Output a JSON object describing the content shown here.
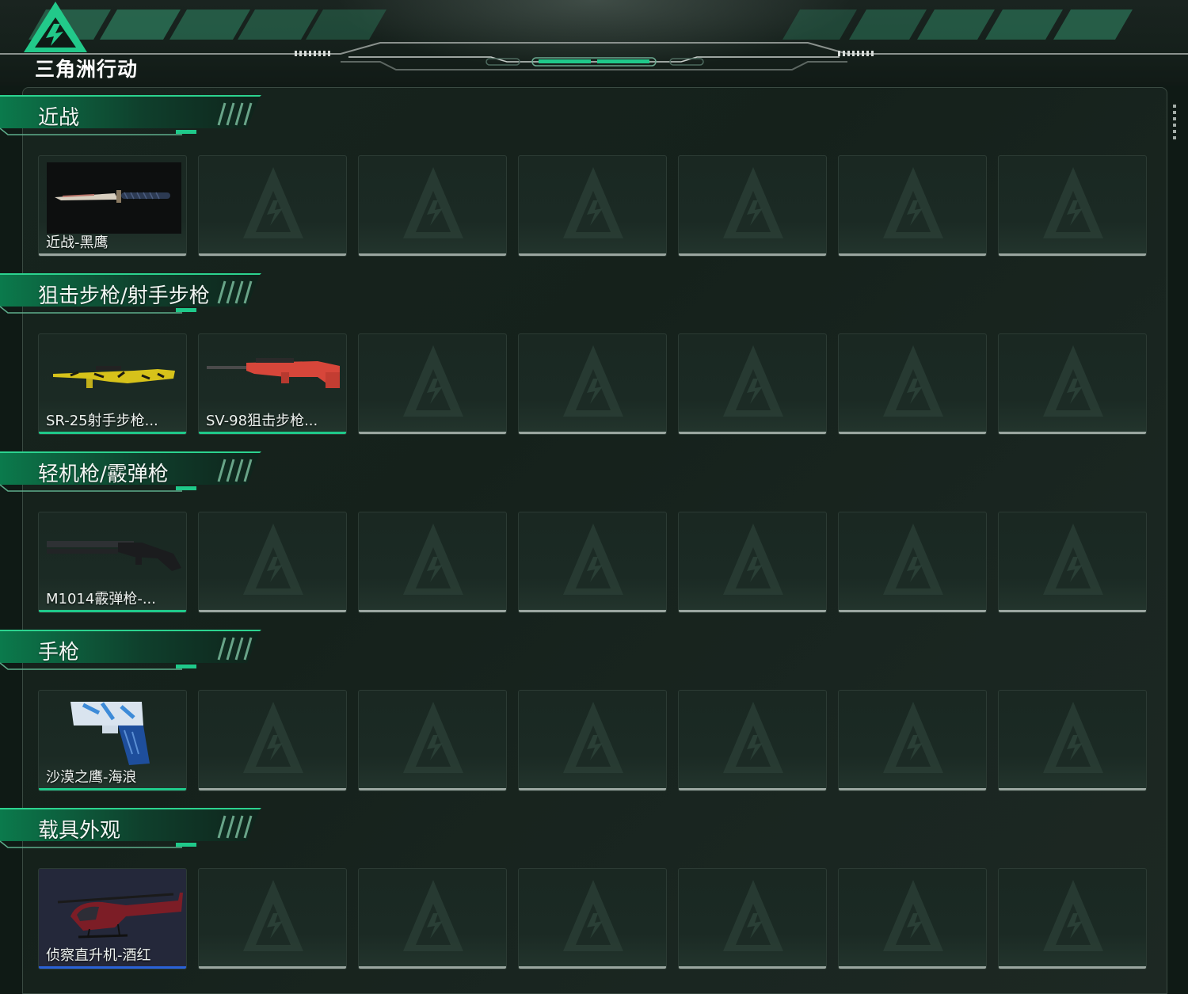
{
  "app": {
    "logo_text": "三角洲行动",
    "accent": "#1fc98a",
    "rarity_colors": {
      "green": "#1fc98a",
      "blue": "#2a62d8",
      "empty": "#9aa6a0"
    }
  },
  "sections": [
    {
      "title": "近战",
      "items": [
        {
          "label": "近战-黑鹰",
          "icon": "combat-knife-icon",
          "rarity": "empty"
        }
      ],
      "empty_slots": 6
    },
    {
      "title": "狙击步枪/射手步枪",
      "items": [
        {
          "label": "SR-25射手步枪...",
          "icon": "yellow-marksman-rifle-icon",
          "rarity": "green"
        },
        {
          "label": "SV-98狙击步枪...",
          "icon": "red-sniper-rifle-icon",
          "rarity": "green"
        }
      ],
      "empty_slots": 5
    },
    {
      "title": "轻机枪/霰弹枪",
      "items": [
        {
          "label": "M1014霰弹枪-...",
          "icon": "black-shotgun-icon",
          "rarity": "green"
        }
      ],
      "empty_slots": 6
    },
    {
      "title": "手枪",
      "items": [
        {
          "label": "沙漠之鹰-海浪",
          "icon": "blue-pistol-icon",
          "rarity": "green"
        }
      ],
      "empty_slots": 6
    },
    {
      "title": "载具外观",
      "items": [
        {
          "label": "侦察直升机-酒红",
          "icon": "red-helicopter-icon",
          "rarity": "blue"
        }
      ],
      "empty_slots": 6
    }
  ]
}
